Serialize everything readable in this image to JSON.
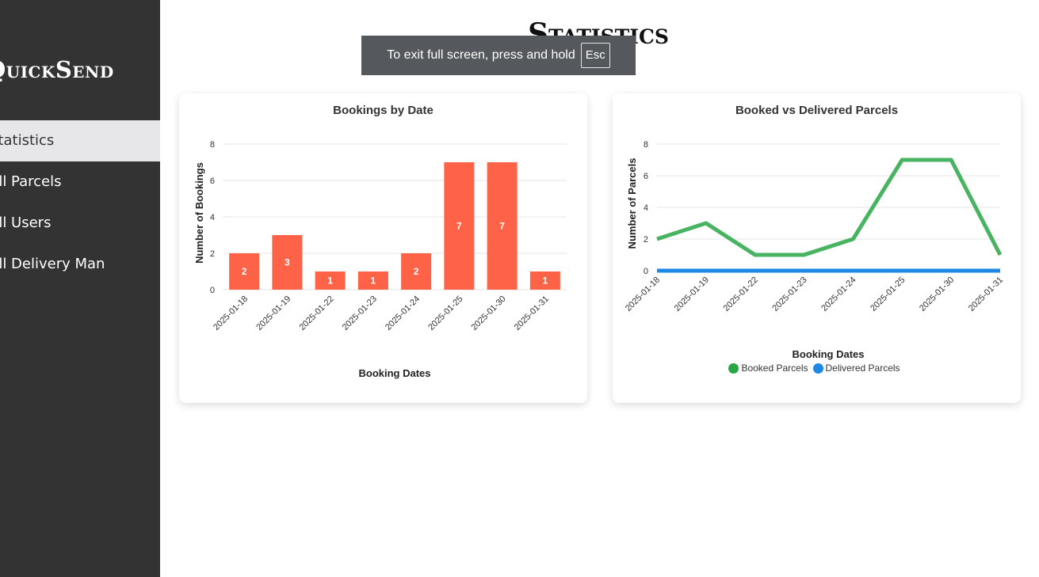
{
  "sidebar": {
    "brand": "QuickSend",
    "items": [
      {
        "label": "Statistics",
        "active": true
      },
      {
        "label": "All Parcels"
      },
      {
        "label": "All Users"
      },
      {
        "label": "All Delivery Man"
      }
    ]
  },
  "page": {
    "title": "Statistics"
  },
  "toast": {
    "message": "To exit full screen, press and hold",
    "key": "Esc"
  },
  "colors": {
    "bar": "#ff6347",
    "booked": "#28a745",
    "delivered": "#1e88e5",
    "sidebar": "#333333"
  },
  "chart_data": [
    {
      "type": "bar",
      "title": "Bookings by Date",
      "xlabel": "Booking Dates",
      "ylabel": "Number of Bookings",
      "categories": [
        "2025-01-18",
        "2025-01-19",
        "2025-01-22",
        "2025-01-23",
        "2025-01-24",
        "2025-01-25",
        "2025-01-30",
        "2025-01-31"
      ],
      "values": [
        2,
        3,
        1,
        1,
        2,
        7,
        7,
        1
      ],
      "ylim": [
        0,
        8
      ],
      "yticks": [
        "0",
        "2",
        "4",
        "6",
        "8"
      ],
      "grid": true,
      "legend": "none"
    },
    {
      "type": "line",
      "title": "Booked vs Delivered Parcels",
      "xlabel": "Booking Dates",
      "ylabel": "Number of Parcels",
      "categories": [
        "2025-01-18",
        "2025-01-19",
        "2025-01-22",
        "2025-01-23",
        "2025-01-24",
        "2025-01-25",
        "2025-01-30",
        "2025-01-31"
      ],
      "series": [
        {
          "name": "Booked Parcels",
          "values": [
            2,
            3,
            1,
            1,
            2,
            7,
            7,
            1
          ]
        },
        {
          "name": "Delivered Parcels",
          "values": [
            0,
            0,
            0,
            0,
            0,
            0,
            0,
            0
          ]
        }
      ],
      "ylim": [
        0,
        8
      ],
      "yticks": [
        "0",
        "2",
        "4",
        "6",
        "8"
      ],
      "grid": true,
      "legend": "bottom"
    }
  ]
}
